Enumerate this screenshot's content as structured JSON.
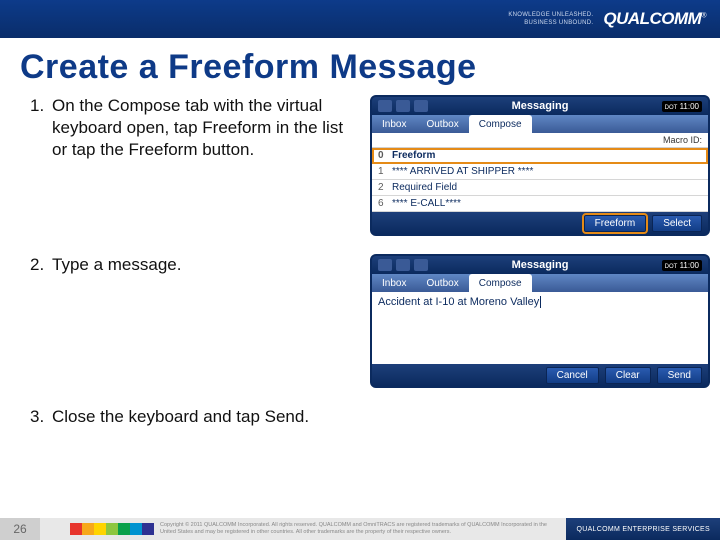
{
  "header": {
    "tagline_line1": "KNOWLEDGE UNLEASHED.",
    "tagline_line2": "BUSINESS UNBOUND.",
    "logo": "QUALCOMM"
  },
  "title": "Create a Freeform Message",
  "steps": {
    "s1": {
      "num": "1.",
      "text": "On the Compose tab with the virtual keyboard open, tap Freeform in the list or tap the Freeform button."
    },
    "s2": {
      "num": "2.",
      "text": "Type a message."
    },
    "s3": {
      "num": "3.",
      "text": "Close the keyboard and tap Send."
    }
  },
  "device1": {
    "header": "Messaging",
    "clock": "11:00",
    "tabs": {
      "inbox": "Inbox",
      "outbox": "Outbox",
      "compose": "Compose"
    },
    "macro_label": "Macro ID:",
    "rows": [
      {
        "idx": "0",
        "label": "Freeform",
        "selected": true
      },
      {
        "idx": "1",
        "label": "**** ARRIVED AT SHIPPER ****",
        "selected": false
      },
      {
        "idx": "2",
        "label": "Required Field",
        "selected": false
      },
      {
        "idx": "6",
        "label": "**** E-CALL****",
        "selected": false
      }
    ],
    "buttons": {
      "freeform": "Freeform",
      "select": "Select"
    }
  },
  "device2": {
    "header": "Messaging",
    "clock": "11:00",
    "tabs": {
      "inbox": "Inbox",
      "outbox": "Outbox",
      "compose": "Compose"
    },
    "message": "Accident at I-10 at Moreno Valley",
    "buttons": {
      "cancel": "Cancel",
      "clear": "Clear",
      "send": "Send"
    }
  },
  "footer": {
    "page": "26",
    "chip_colors": [
      "#e7352c",
      "#f7a81b",
      "#ffd400",
      "#8dc63f",
      "#0aa04a",
      "#0093d0",
      "#2e3192"
    ],
    "legal": "Copyright © 2011 QUALCOMM Incorporated. All rights reserved. QUALCOMM and OmniTRACS are registered trademarks of QUALCOMM Incorporated in the United States and may be registered in other countries. All other trademarks are the property of their respective owners.",
    "qes": "QUALCOMM ENTERPRISE SERVICES"
  }
}
